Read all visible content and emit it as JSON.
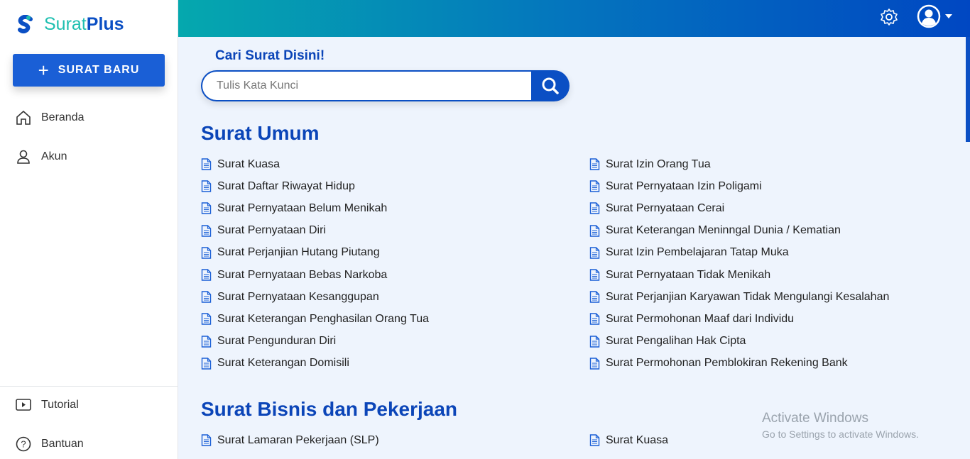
{
  "sidebar": {
    "brand_a": "Surat",
    "brand_b": "Plus",
    "new_button": "SURAT BARU",
    "nav": [
      {
        "label": "Beranda",
        "icon": "home-icon"
      },
      {
        "label": "Akun",
        "icon": "user-icon"
      }
    ],
    "bottom_nav": [
      {
        "label": "Tutorial",
        "icon": "play-icon"
      },
      {
        "label": "Bantuan",
        "icon": "help-icon"
      }
    ]
  },
  "search": {
    "title": "Cari Surat Disini!",
    "placeholder": "Tulis Kata Kunci",
    "value": ""
  },
  "sections": [
    {
      "title": "Surat Umum",
      "left": [
        "Surat Kuasa",
        "Surat Daftar Riwayat Hidup",
        "Surat Pernyataan Belum Menikah",
        "Surat Pernyataan Diri",
        "Surat Perjanjian Hutang Piutang",
        "Surat Pernyataan Bebas Narkoba",
        "Surat Pernyataan Kesanggupan",
        "Surat Keterangan Penghasilan Orang Tua",
        "Surat Pengunduran Diri",
        "Surat Keterangan Domisili"
      ],
      "right": [
        "Surat Izin Orang Tua",
        "Surat Pernyataan Izin Poligami",
        "Surat Pernyataan Cerai",
        "Surat Keterangan Meninngal Dunia / Kematian",
        "Surat Izin Pembelajaran Tatap Muka",
        "Surat Pernyataan Tidak Menikah",
        "Surat Perjanjian Karyawan Tidak Mengulangi Kesalahan",
        "Surat Permohonan Maaf dari Individu",
        "Surat Pengalihan Hak Cipta",
        "Surat Permohonan Pemblokiran Rekening Bank"
      ]
    },
    {
      "title": "Surat Bisnis dan Pekerjaan",
      "left": [
        "Surat Lamaran Pekerjaan (SLP)"
      ],
      "right": [
        "Surat Kuasa"
      ]
    }
  ],
  "watermark": {
    "line1": "Activate Windows",
    "line2": "Go to Settings to activate Windows."
  }
}
